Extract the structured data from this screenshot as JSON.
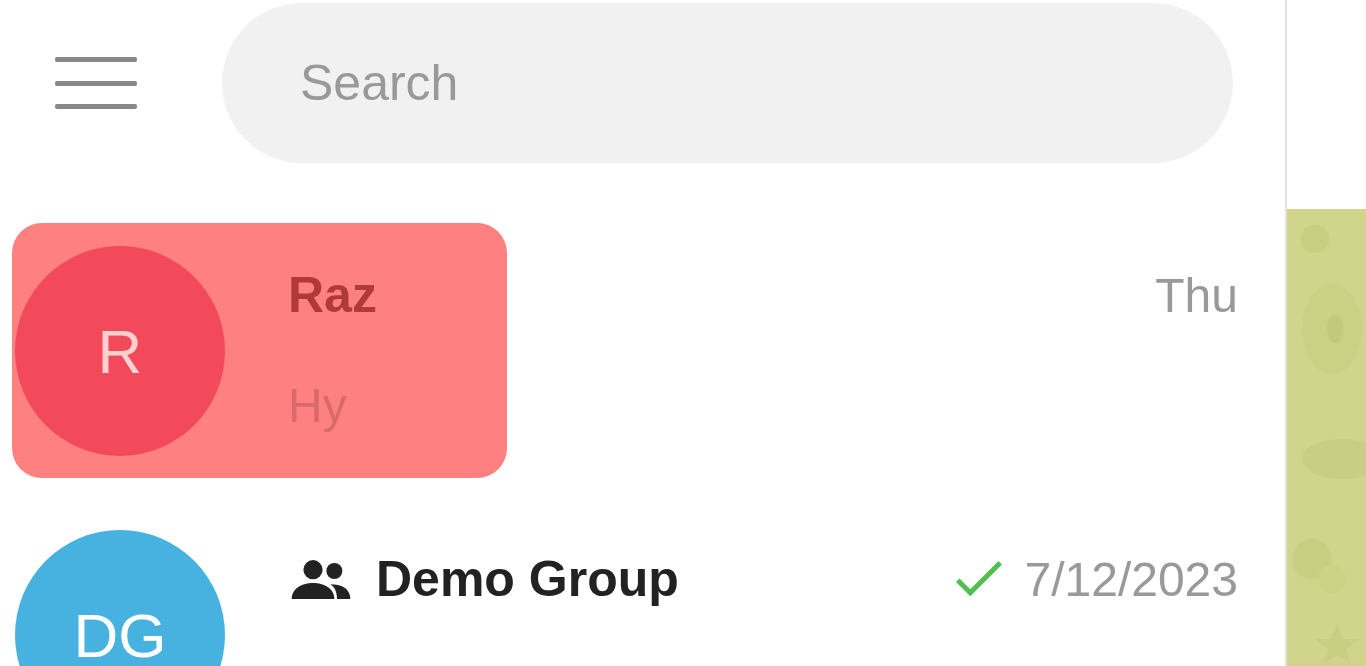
{
  "search": {
    "placeholder": "Search"
  },
  "chats": [
    {
      "kind": "private",
      "initials": "R",
      "color": "#f24a5b",
      "name": "Raz",
      "time": "Thu",
      "preview": "Hy",
      "delivered": false,
      "highlighted": true
    },
    {
      "kind": "group",
      "initials": "DG",
      "color": "#47b2e0",
      "name": "Demo Group",
      "time": "7/12/2023",
      "delivered": true,
      "highlighted": false
    }
  ]
}
